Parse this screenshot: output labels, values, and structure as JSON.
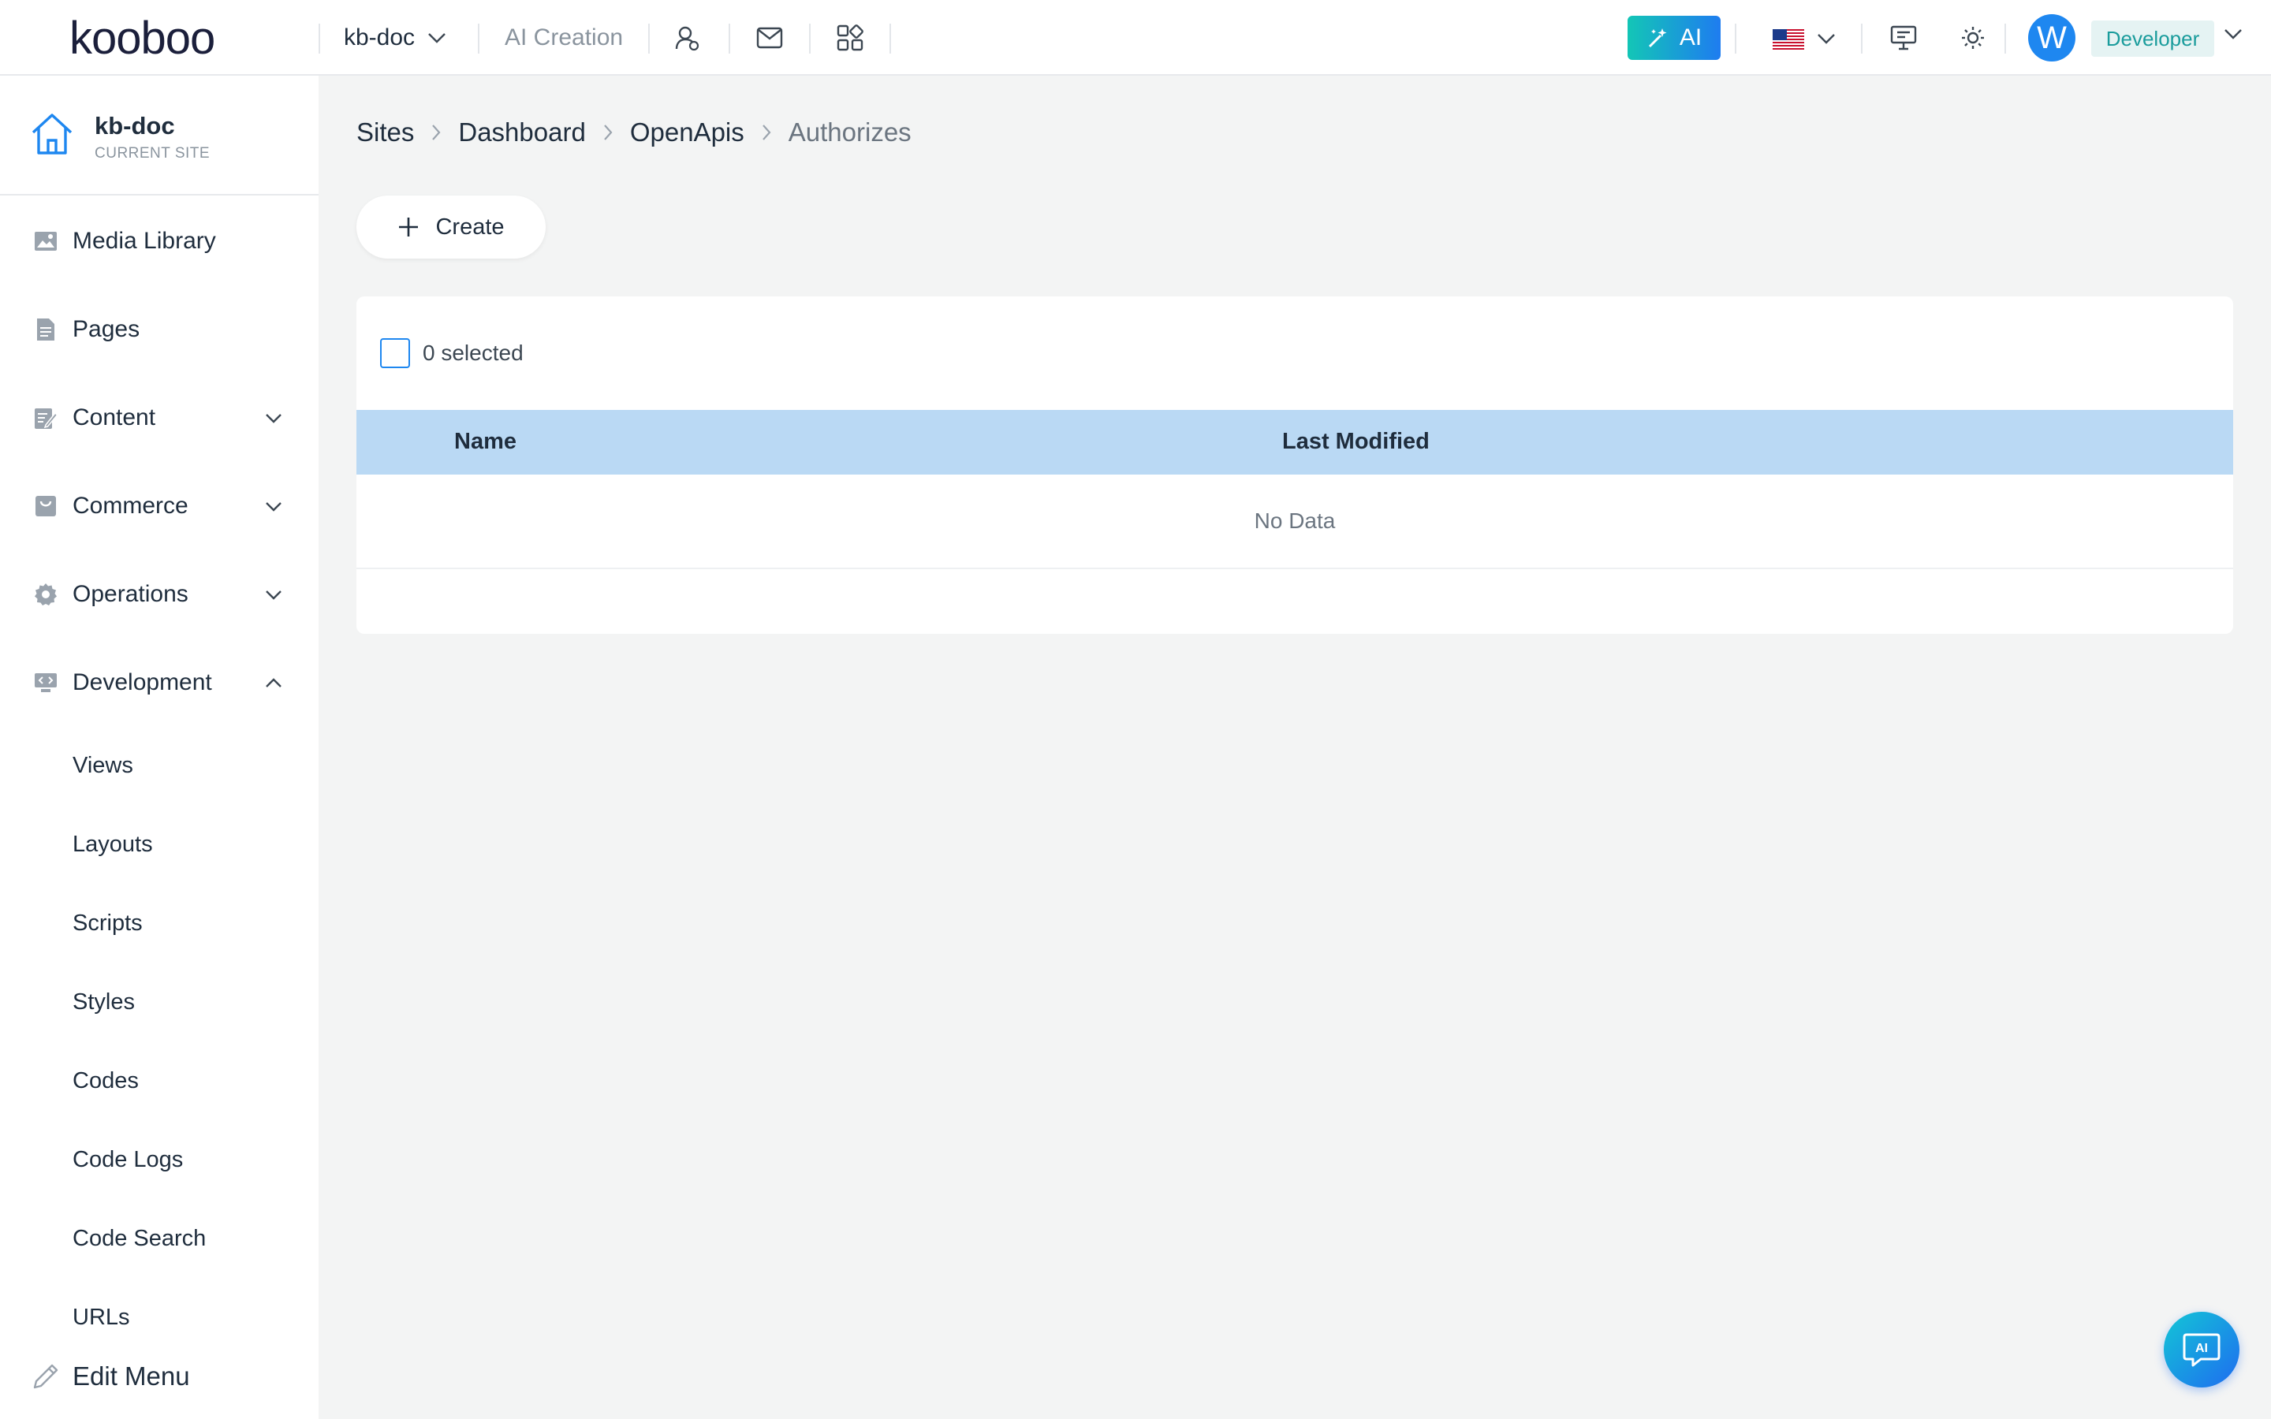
{
  "topbar": {
    "logo": "kooboo",
    "site": "kb-doc",
    "ai_creation": "AI Creation",
    "ai_button": "AI",
    "avatar_initial": "W",
    "role": "Developer",
    "accent": "#1e87f0"
  },
  "sidebar": {
    "current_site": {
      "name": "kb-doc",
      "caption": "CURRENT SITE"
    },
    "items": [
      {
        "label": "Media Library",
        "icon": "image-icon"
      },
      {
        "label": "Pages",
        "icon": "page-icon"
      },
      {
        "label": "Content",
        "icon": "content-icon",
        "expandable": true
      },
      {
        "label": "Commerce",
        "icon": "commerce-icon",
        "expandable": true
      },
      {
        "label": "Operations",
        "icon": "gear-icon",
        "expandable": true
      },
      {
        "label": "Development",
        "icon": "dev-icon",
        "expanded": true
      }
    ],
    "development_children": [
      "Views",
      "Layouts",
      "Scripts",
      "Styles",
      "Codes",
      "Code Logs",
      "Code Search",
      "URLs"
    ],
    "edit_menu": "Edit Menu"
  },
  "breadcrumb": [
    "Sites",
    "Dashboard",
    "OpenApis",
    "Authorizes"
  ],
  "toolbar": {
    "create_label": "Create"
  },
  "table": {
    "selected_text": "0 selected",
    "columns": [
      "Name",
      "Last Modified"
    ],
    "empty_text": "No Data"
  },
  "fab": {
    "label": "AI"
  }
}
